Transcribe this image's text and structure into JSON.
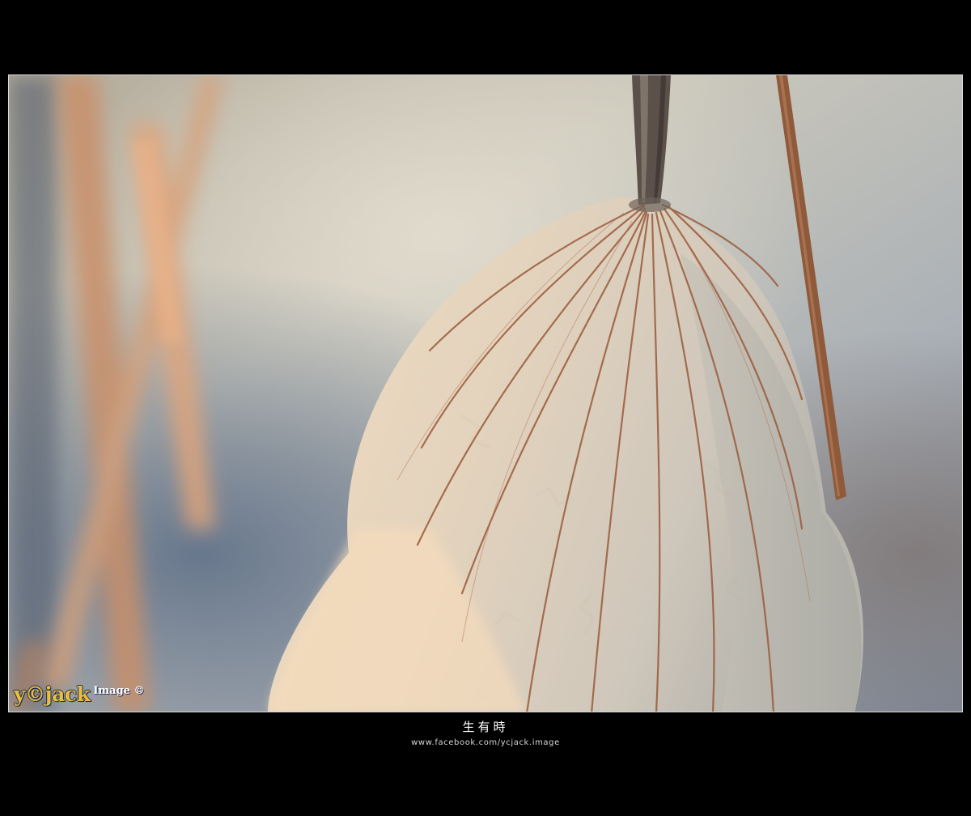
{
  "photo": {
    "subject": "dried-lotus-leaf",
    "colors": {
      "background_light": "#c9c6b8",
      "background_blue": "#6f7d92",
      "leaf_light": "#e8dcc6",
      "leaf_vein": "#9a5a3a",
      "stem": "#8a5a3c",
      "frame_border": "#d8d8d8"
    }
  },
  "watermark": {
    "main": "y©jack",
    "sub": "Image ©"
  },
  "caption": {
    "title": "生有時",
    "url": "www.facebook.com/ycjack.image"
  }
}
